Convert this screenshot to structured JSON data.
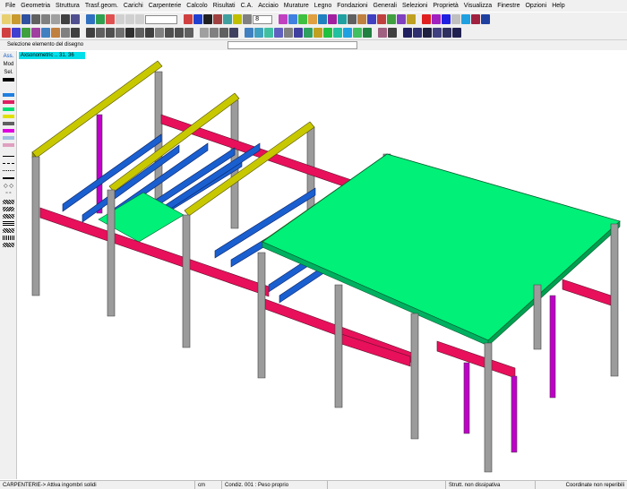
{
  "menu": [
    "File",
    "Geometria",
    "Struttura",
    "Trasf.geom.",
    "Carichi",
    "Carpenterie",
    "Calcolo",
    "Risultati",
    "C.A.",
    "Acciaio",
    "Murature",
    "Legno",
    "Fondazioni",
    "Generali",
    "Selezioni",
    "Proprietà",
    "Visualizza",
    "Finestre",
    "Opzioni",
    "Help"
  ],
  "toolbar": {
    "scale_value": "8"
  },
  "infobar": {
    "text": "Selezione  elemento del disegno"
  },
  "sidebar": {
    "ass": "Ass.",
    "mod": "Mod",
    "sel": "Sel."
  },
  "view": {
    "label": "Axsonometric .. 31. 36"
  },
  "status": {
    "mode": "CARPENTERIE-> Attiva ingombri solidi",
    "unit": "cm",
    "condition": "Condiz. 001 : Peso proprio",
    "structure": "Strutt. non dissipativa",
    "coords": "Coordinate non reperibili"
  },
  "colors": {
    "beam_yellow": "#c8c800",
    "beam_blue": "#1a5fd0",
    "beam_red": "#e8105a",
    "column_gray": "#9b9b9b",
    "column_magenta": "#c000c8",
    "slab_green": "#00f078",
    "view_label_bg": "#00e0ea"
  }
}
